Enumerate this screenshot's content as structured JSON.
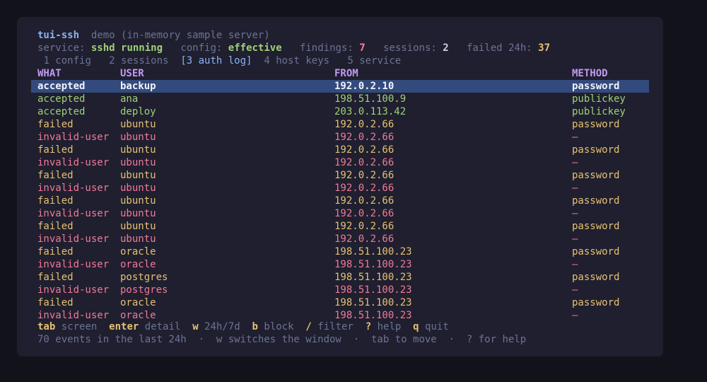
{
  "header": {
    "app_name": "tui-ssh",
    "subtitle": "demo (in-memory sample server)"
  },
  "status": {
    "service_label": "service:",
    "service_value": "sshd running",
    "config_label": "config:",
    "config_value": "effective",
    "findings_label": "findings:",
    "findings_value": "7",
    "sessions_label": "sessions:",
    "sessions_value": "2",
    "failed_label": "failed 24h:",
    "failed_value": "37"
  },
  "tabs": [
    {
      "label": "1 config"
    },
    {
      "label": "2 sessions"
    },
    {
      "label": "[3 auth log]"
    },
    {
      "label": "4 host keys"
    },
    {
      "label": "5 service"
    }
  ],
  "table": {
    "columns": [
      "WHAT",
      "USER",
      "FROM",
      "METHOD"
    ],
    "rows": [
      {
        "what": "accepted",
        "user": "backup",
        "from": "192.0.2.10",
        "method": "password",
        "kind": "selected"
      },
      {
        "what": "accepted",
        "user": "ana",
        "from": "198.51.100.9",
        "method": "publickey",
        "kind": "accepted"
      },
      {
        "what": "accepted",
        "user": "deploy",
        "from": "203.0.113.42",
        "method": "publickey",
        "kind": "accepted"
      },
      {
        "what": "failed",
        "user": "ubuntu",
        "from": "192.0.2.66",
        "method": "password",
        "kind": "failed"
      },
      {
        "what": "invalid-user",
        "user": "ubuntu",
        "from": "192.0.2.66",
        "method": "—",
        "kind": "invalid"
      },
      {
        "what": "failed",
        "user": "ubuntu",
        "from": "192.0.2.66",
        "method": "password",
        "kind": "failed"
      },
      {
        "what": "invalid-user",
        "user": "ubuntu",
        "from": "192.0.2.66",
        "method": "—",
        "kind": "invalid"
      },
      {
        "what": "failed",
        "user": "ubuntu",
        "from": "192.0.2.66",
        "method": "password",
        "kind": "failed"
      },
      {
        "what": "invalid-user",
        "user": "ubuntu",
        "from": "192.0.2.66",
        "method": "—",
        "kind": "invalid"
      },
      {
        "what": "failed",
        "user": "ubuntu",
        "from": "192.0.2.66",
        "method": "password",
        "kind": "failed"
      },
      {
        "what": "invalid-user",
        "user": "ubuntu",
        "from": "192.0.2.66",
        "method": "—",
        "kind": "invalid"
      },
      {
        "what": "failed",
        "user": "ubuntu",
        "from": "192.0.2.66",
        "method": "password",
        "kind": "failed"
      },
      {
        "what": "invalid-user",
        "user": "ubuntu",
        "from": "192.0.2.66",
        "method": "—",
        "kind": "invalid"
      },
      {
        "what": "failed",
        "user": "oracle",
        "from": "198.51.100.23",
        "method": "password",
        "kind": "failed"
      },
      {
        "what": "invalid-user",
        "user": "oracle",
        "from": "198.51.100.23",
        "method": "—",
        "kind": "invalid"
      },
      {
        "what": "failed",
        "user": "postgres",
        "from": "198.51.100.23",
        "method": "password",
        "kind": "failed"
      },
      {
        "what": "invalid-user",
        "user": "postgres",
        "from": "198.51.100.23",
        "method": "—",
        "kind": "invalid"
      },
      {
        "what": "failed",
        "user": "oracle",
        "from": "198.51.100.23",
        "method": "password",
        "kind": "failed"
      },
      {
        "what": "invalid-user",
        "user": "oracle",
        "from": "198.51.100.23",
        "method": "—",
        "kind": "invalid"
      }
    ]
  },
  "keys": [
    {
      "key": "tab",
      "action": "screen"
    },
    {
      "key": "enter",
      "action": "detail"
    },
    {
      "key": "w",
      "action": "24h/7d"
    },
    {
      "key": "b",
      "action": "block"
    },
    {
      "key": "/",
      "action": "filter"
    },
    {
      "key": "?",
      "action": "help"
    },
    {
      "key": "q",
      "action": "quit"
    }
  ],
  "footer": {
    "message": "70 events in the last 24h  ·  w switches the window  ·  tab to move  ·  ? for help"
  },
  "colors": {
    "background": "#12121b",
    "panel": "#1f1f2f",
    "selection": "#334a7c",
    "accepted": "#9fd078",
    "failed": "#e6c172",
    "invalid": "#f07a98",
    "header": "#c39af0"
  }
}
